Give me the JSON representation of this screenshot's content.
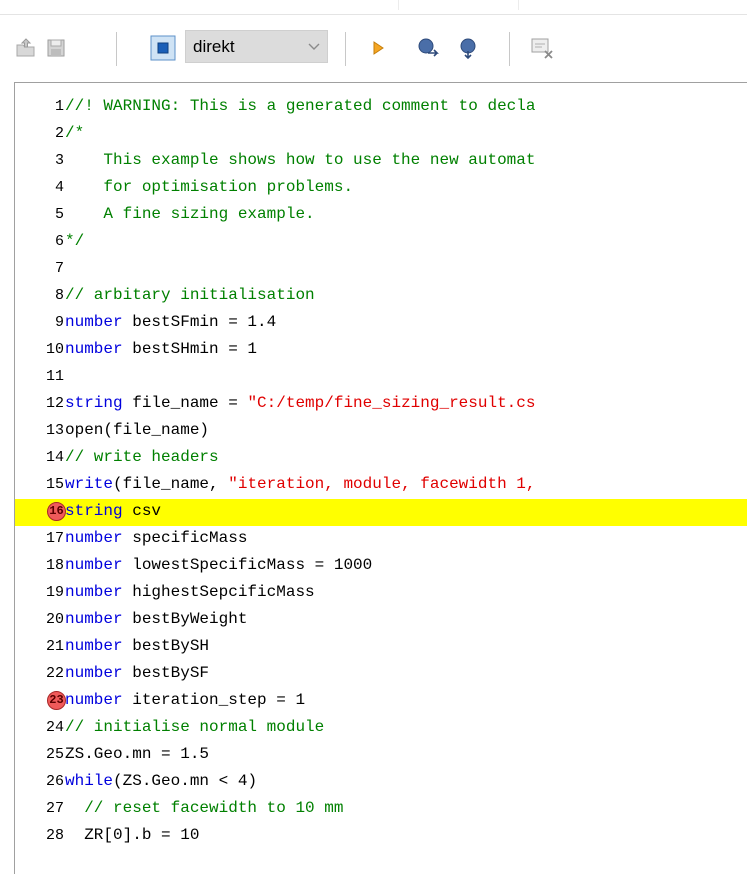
{
  "toolbar": {
    "dropdown_value": "direkt",
    "icons": [
      "open-folder-icon",
      "save-icon",
      "stop-icon",
      "run-icon",
      "step-over-icon",
      "step-into-icon",
      "clear-breakpoints-icon"
    ]
  },
  "editor": {
    "colors": {
      "keyword": "#0000dd",
      "string": "#e00000",
      "comment": "#008000",
      "highlight": "#ffff00",
      "breakpoint": "#f05a5a"
    },
    "lines": [
      {
        "num": "1",
        "tokens": [
          {
            "t": "cmt",
            "v": "//! WARNING: This is a generated comment to decla"
          }
        ]
      },
      {
        "num": "2",
        "tokens": [
          {
            "t": "cmt",
            "v": "/*"
          }
        ]
      },
      {
        "num": "3",
        "tokens": [
          {
            "t": "cmt",
            "v": "    This example shows how to use the new automat"
          }
        ]
      },
      {
        "num": "4",
        "tokens": [
          {
            "t": "cmt",
            "v": "    for optimisation problems."
          }
        ]
      },
      {
        "num": "5",
        "tokens": [
          {
            "t": "cmt",
            "v": "    A fine sizing example."
          }
        ]
      },
      {
        "num": "6",
        "tokens": [
          {
            "t": "cmt",
            "v": "*/"
          }
        ]
      },
      {
        "num": "7",
        "tokens": []
      },
      {
        "num": "8",
        "tokens": [
          {
            "t": "cmt",
            "v": "// arbitary initialisation"
          }
        ]
      },
      {
        "num": "9",
        "tokens": [
          {
            "t": "kw",
            "v": "number"
          },
          {
            "t": "pl",
            "v": " bestSFmin = 1.4"
          }
        ]
      },
      {
        "num": "10",
        "tokens": [
          {
            "t": "kw",
            "v": "number"
          },
          {
            "t": "pl",
            "v": " bestSHmin = 1"
          }
        ]
      },
      {
        "num": "11",
        "tokens": []
      },
      {
        "num": "12",
        "tokens": [
          {
            "t": "kw",
            "v": "string"
          },
          {
            "t": "pl",
            "v": " file_name = "
          },
          {
            "t": "str",
            "v": "\"C:/temp/fine_sizing_result.cs"
          }
        ]
      },
      {
        "num": "13",
        "tokens": [
          {
            "t": "pl",
            "v": "open(file_name)"
          }
        ]
      },
      {
        "num": "14",
        "tokens": [
          {
            "t": "cmt",
            "v": "// write headers"
          }
        ]
      },
      {
        "num": "15",
        "tokens": [
          {
            "t": "kw",
            "v": "write"
          },
          {
            "t": "pl",
            "v": "(file_name, "
          },
          {
            "t": "str",
            "v": "\"iteration, module, facewidth 1,"
          }
        ]
      },
      {
        "num": "16",
        "breakpoint": true,
        "highlight": true,
        "tokens": [
          {
            "t": "kw",
            "v": "string"
          },
          {
            "t": "pl",
            "v": " csv"
          }
        ]
      },
      {
        "num": "17",
        "tokens": [
          {
            "t": "kw",
            "v": "number"
          },
          {
            "t": "pl",
            "v": " specificMass"
          }
        ]
      },
      {
        "num": "18",
        "tokens": [
          {
            "t": "kw",
            "v": "number"
          },
          {
            "t": "pl",
            "v": " lowestSpecificMass = 1000"
          }
        ]
      },
      {
        "num": "19",
        "tokens": [
          {
            "t": "kw",
            "v": "number"
          },
          {
            "t": "pl",
            "v": " highestSepcificMass"
          }
        ]
      },
      {
        "num": "20",
        "tokens": [
          {
            "t": "kw",
            "v": "number"
          },
          {
            "t": "pl",
            "v": " bestByWeight"
          }
        ]
      },
      {
        "num": "21",
        "tokens": [
          {
            "t": "kw",
            "v": "number"
          },
          {
            "t": "pl",
            "v": " bestBySH"
          }
        ]
      },
      {
        "num": "22",
        "tokens": [
          {
            "t": "kw",
            "v": "number"
          },
          {
            "t": "pl",
            "v": " bestBySF"
          }
        ]
      },
      {
        "num": "23",
        "breakpoint": true,
        "tokens": [
          {
            "t": "kw",
            "v": "number"
          },
          {
            "t": "pl",
            "v": " iteration_step = 1"
          }
        ]
      },
      {
        "num": "24",
        "tokens": [
          {
            "t": "cmt",
            "v": "// initialise normal module"
          }
        ]
      },
      {
        "num": "25",
        "tokens": [
          {
            "t": "pl",
            "v": "ZS.Geo.mn = 1.5"
          }
        ]
      },
      {
        "num": "26",
        "tokens": [
          {
            "t": "kw",
            "v": "while"
          },
          {
            "t": "pl",
            "v": "(ZS.Geo.mn < 4)"
          }
        ]
      },
      {
        "num": "27",
        "tokens": [
          {
            "t": "cmt",
            "v": "  // reset facewidth to 10 mm"
          }
        ]
      },
      {
        "num": "28",
        "tokens": [
          {
            "t": "pl",
            "v": "  ZR[0].b = 10"
          }
        ]
      }
    ]
  }
}
